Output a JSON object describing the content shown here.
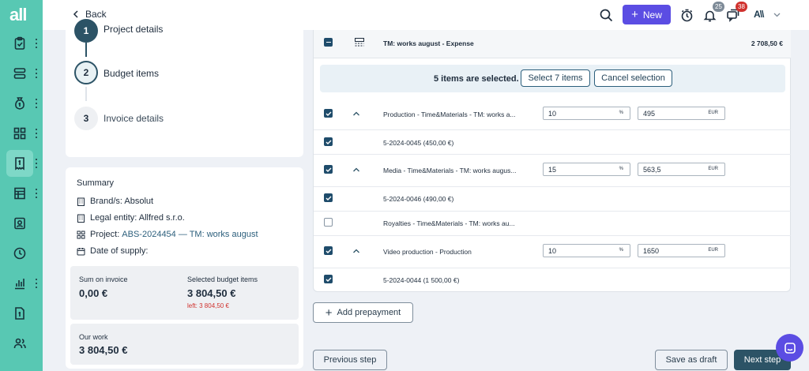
{
  "app": {
    "logo": "all"
  },
  "sidebar": {
    "items": [
      {
        "icon": "clipboard-check-icon"
      },
      {
        "icon": "layers-icon"
      },
      {
        "icon": "money-bag-icon"
      },
      {
        "icon": "grid-icon"
      },
      {
        "icon": "invoice-icon",
        "active": true
      },
      {
        "icon": "table-icon"
      },
      {
        "icon": "contact-icon"
      },
      {
        "icon": "clock-icon"
      },
      {
        "icon": "bar-chart-icon"
      },
      {
        "icon": "document-dollar-icon"
      },
      {
        "icon": "users-icon"
      }
    ]
  },
  "topbar": {
    "back_label": "Back",
    "new_label": "New",
    "notifications_count": "25",
    "messages_count": "38",
    "user_initials": "A\\\\"
  },
  "steps": [
    {
      "number": "1",
      "label": "Project details"
    },
    {
      "number": "2",
      "label": "Budget items"
    },
    {
      "number": "3",
      "label": "Invoice details"
    }
  ],
  "summary": {
    "title": "Summary",
    "brand": "Brand/s: Absolut",
    "legal_entity": "Legal entity: Allfred s.r.o.",
    "project_prefix": "Project:",
    "project_link": "ABS-2024454 — TM: works august",
    "date_of_supply": "Date of supply:",
    "sum_on_invoice_label": "Sum on invoice",
    "sum_on_invoice_value": "0,00 €",
    "selected_items_label": "Selected budget items",
    "selected_items_value": "3 804,50 €",
    "left_value": "left: 3 804,50 €",
    "our_work_label": "Our work",
    "our_work_value": "3 804,50 €"
  },
  "expense_header": {
    "title": "TM: works august - Expense",
    "amount": "2 708,50 €"
  },
  "selection": {
    "text": "5 items are selected.",
    "select_all_label": "Select 7 items",
    "cancel_label": "Cancel selection"
  },
  "rows": [
    {
      "type": "group",
      "checked": true,
      "name": "Production - Time&Materials - TM: works a...",
      "percent": "10",
      "percent_unit": "%",
      "amount": "495",
      "currency": "EUR"
    },
    {
      "type": "sub",
      "checked": true,
      "name": "5-2024-0045 (450,00 €)"
    },
    {
      "type": "group",
      "checked": true,
      "name": "Media - Time&Materials - TM: works augus...",
      "percent": "15",
      "percent_unit": "%",
      "amount": "563,5",
      "currency": "EUR"
    },
    {
      "type": "sub",
      "checked": true,
      "name": "5-2024-0046 (490,00 €)"
    },
    {
      "type": "plain",
      "checked": false,
      "name": "Royalties - Time&Materials - TM: works au..."
    },
    {
      "type": "group",
      "checked": true,
      "name": "Video production - Production",
      "percent": "10",
      "percent_unit": "%",
      "amount": "1650",
      "currency": "EUR"
    },
    {
      "type": "sub",
      "checked": true,
      "name": "5-2024-0044 (1 500,00 €)"
    }
  ],
  "actions": {
    "add_prepayment": "Add prepayment",
    "previous": "Previous step",
    "save_draft": "Save as draft",
    "next": "Next step"
  },
  "colors": {
    "sidebar": "#58c8b3",
    "primary": "#5b4de3",
    "dark": "#2c5366",
    "danger": "#d0312d"
  }
}
